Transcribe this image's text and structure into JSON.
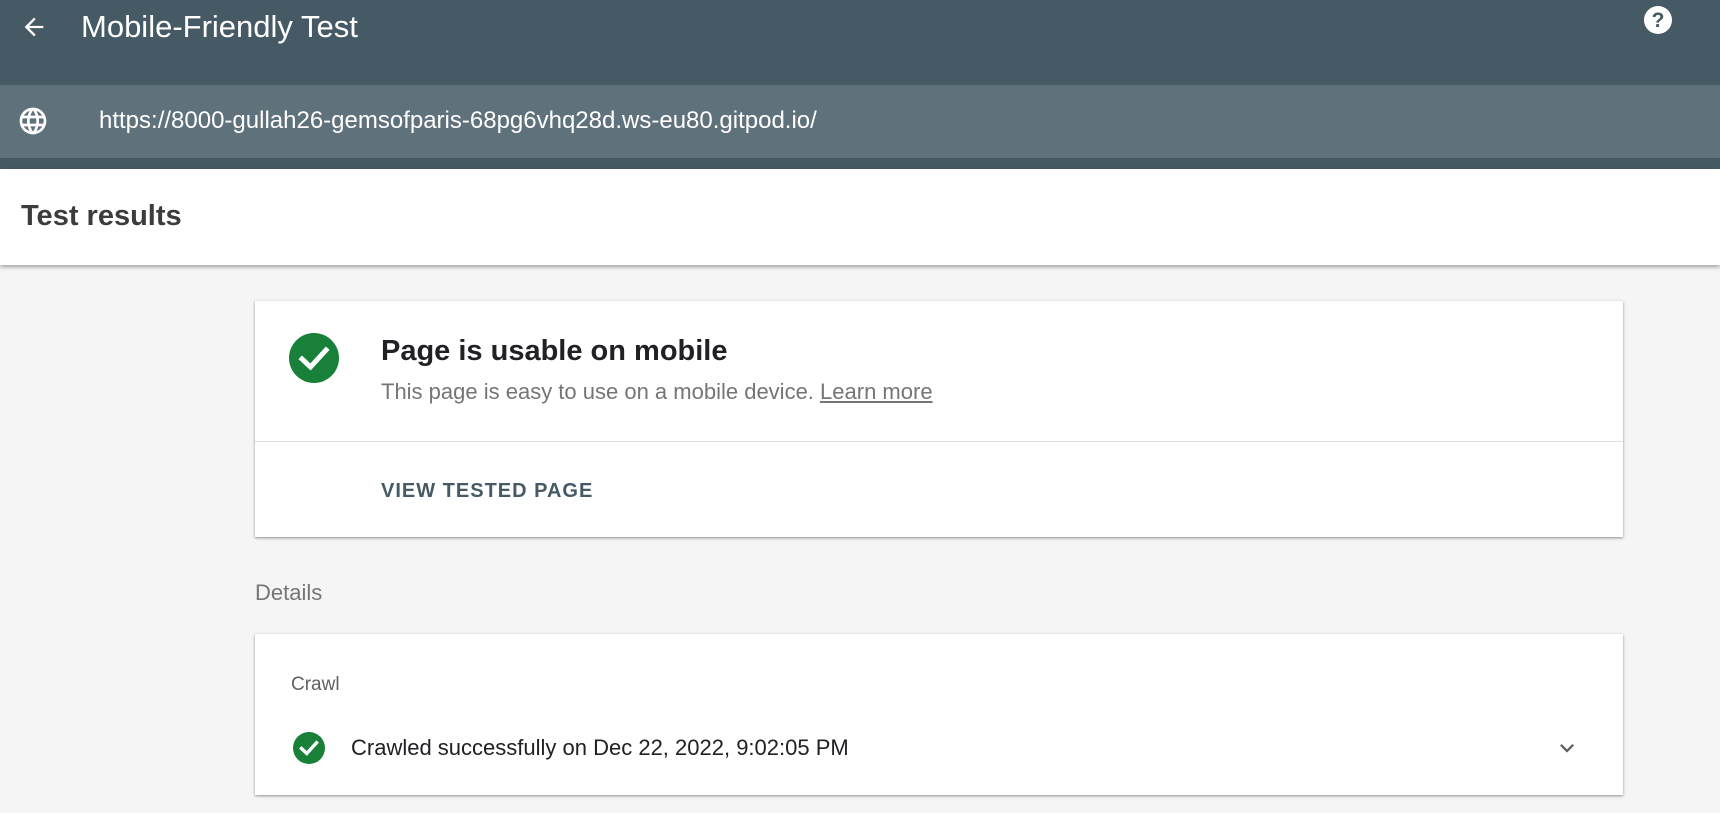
{
  "app": {
    "title": "Mobile-Friendly Test",
    "back_icon": "arrow-back-icon",
    "help_icon": "help-icon"
  },
  "url_bar": {
    "icon": "globe-icon",
    "url": "https://8000-gullah26-gemsofparis-68pg6vhq28d.ws-eu80.gitpod.io/"
  },
  "results": {
    "title": "Test results"
  },
  "usable_card": {
    "icon": "check-circle-icon",
    "title": "Page is usable on mobile",
    "description": "This page is easy to use on a mobile device.",
    "learn_more": "Learn more",
    "view_button": "VIEW TESTED PAGE"
  },
  "details": {
    "label": "Details",
    "crawl_label": "Crawl",
    "crawl_icon": "check-circle-icon",
    "crawl_status": "Crawled successfully on Dec 22, 2022, 9:02:05 PM",
    "expand_icon": "chevron-down-icon"
  },
  "colors": {
    "header_bg": "#455a64",
    "url_bar_bg": "#5f717b",
    "success_green": "#188038",
    "page_bg": "#f5f5f5"
  }
}
